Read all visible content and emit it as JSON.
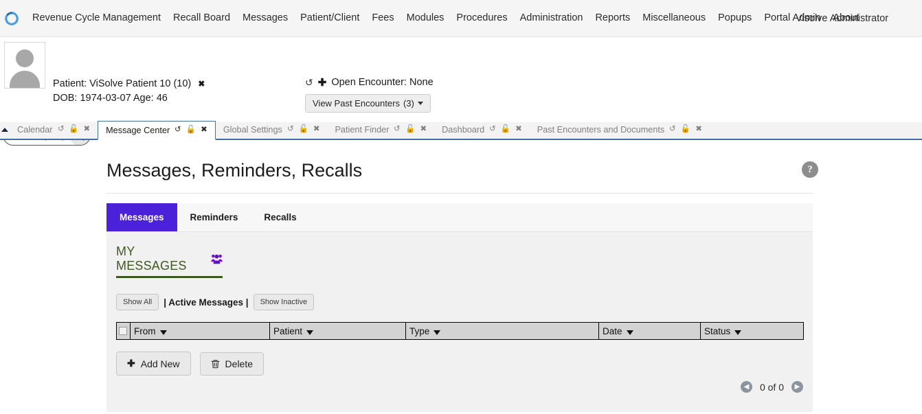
{
  "topnav": {
    "logo_icon": "circular-spinner-logo",
    "links": [
      "Revenue Cycle Management",
      "Recall Board",
      "Messages",
      "Patient/Client",
      "Fees",
      "Modules",
      "Procedures",
      "Administration",
      "Reports",
      "Miscellaneous",
      "Popups",
      "Portal Admin",
      "About"
    ],
    "user": "Visolve Administrator"
  },
  "patient_bar": {
    "avatar_icon": "user-avatar-placeholder",
    "patient_line": "Patient: ViSolve Patient 10 (10)",
    "close_label": "✖",
    "dob_line": "DOB: 1974-03-07 Age: 46",
    "refresh_icon": "refresh-icon",
    "add_icon": "plus-icon",
    "open_encounter": "Open Encounter: None",
    "past_encounters_label": "View Past Encounters",
    "past_encounters_count": "(3)",
    "search_placeholder": "Search by any demographics",
    "search_value": "",
    "search_icon": "magnifier-icon"
  },
  "tabstrip": {
    "collapse_icon": "triangle-up-icon",
    "tabs": [
      {
        "label": "Calendar",
        "active": false
      },
      {
        "label": "Message Center",
        "active": true
      },
      {
        "label": "Global Settings",
        "active": false
      },
      {
        "label": "Patient Finder",
        "active": false
      },
      {
        "label": "Dashboard",
        "active": false
      },
      {
        "label": "Past Encounters and Documents",
        "active": false
      }
    ],
    "icons": {
      "refresh": "refresh-icon",
      "lock": "unlocked-padlock-icon",
      "close": "close-x-icon"
    }
  },
  "page": {
    "title": "Messages, Reminders, Recalls",
    "help_icon": "help-question-icon",
    "help_label": "?",
    "subtabs": [
      {
        "label": "Messages",
        "active": true
      },
      {
        "label": "Reminders",
        "active": false
      },
      {
        "label": "Recalls",
        "active": false
      }
    ]
  },
  "panel": {
    "section_title": "MY MESSAGES",
    "group_icon": "users-group-icon",
    "filters": {
      "show_all": "Show All",
      "active_label": "| Active Messages |",
      "show_inactive": "Show Inactive"
    },
    "table": {
      "select_all_checkbox": "select-all",
      "columns": [
        "From",
        "Patient",
        "Type",
        "Date",
        "Status"
      ],
      "rows": []
    },
    "actions": {
      "add_icon": "plus-icon",
      "add_label": "Add New",
      "delete_icon": "trash-icon",
      "delete_label": "Delete"
    },
    "pager": {
      "prev_icon": "chevron-left-circle-icon",
      "next_icon": "chevron-right-circle-icon",
      "text": "0 of 0"
    }
  },
  "colors": {
    "accent_purple": "#4b22d9",
    "section_green": "#3d5a1e",
    "tab_border_blue": "#3f6ea8",
    "header_gray": "#d3d3d3",
    "panel_gray": "#f1f1f1"
  }
}
